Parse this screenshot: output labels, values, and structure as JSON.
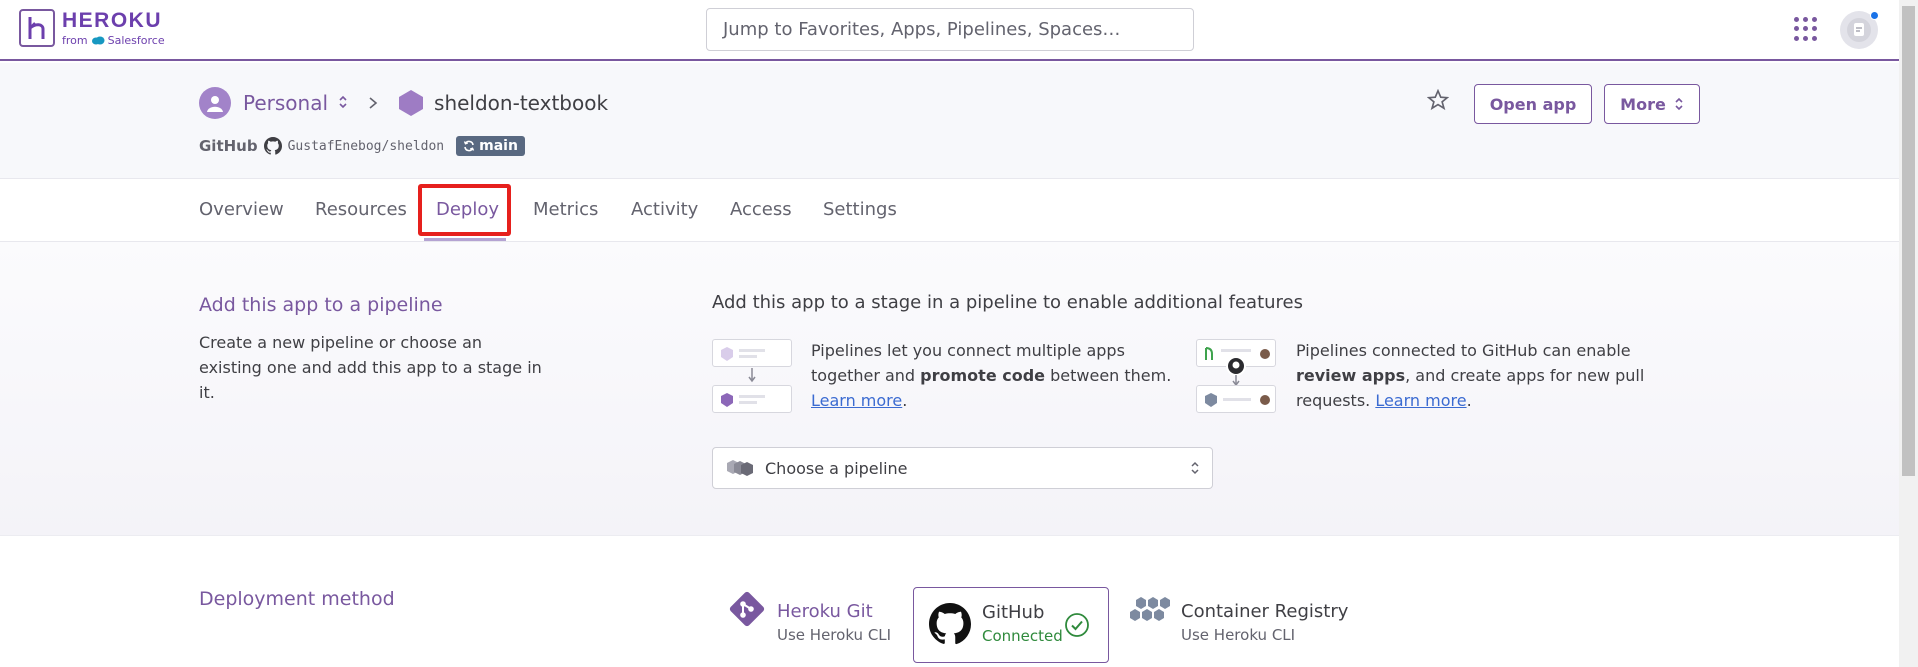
{
  "topbar": {
    "logo_title": "HEROKU",
    "logo_from": "from",
    "logo_brand": "Salesforce",
    "search_placeholder": "Jump to Favorites, Apps, Pipelines, Spaces…"
  },
  "header": {
    "account": "Personal",
    "app_name": "sheldon-textbook",
    "source_label": "GitHub",
    "repo": "GustafEnebog/sheldon",
    "branch": "main",
    "open_app_label": "Open app",
    "more_label": "More"
  },
  "tabs": [
    {
      "label": "Overview"
    },
    {
      "label": "Resources"
    },
    {
      "label": "Deploy"
    },
    {
      "label": "Metrics"
    },
    {
      "label": "Activity"
    },
    {
      "label": "Access"
    },
    {
      "label": "Settings"
    }
  ],
  "active_tab": "Deploy",
  "pipeline": {
    "title": "Add this app to a pipeline",
    "description": "Create a new pipeline or choose an existing one and add this app to a stage in it.",
    "heading": "Add this app to a stage in a pipeline to enable additional features",
    "feature1_a": "Pipelines let you connect multiple apps together and ",
    "feature1_b": "promote code",
    "feature1_c": " between them. ",
    "feature1_link": "Learn more",
    "feature2_a": "Pipelines connected to GitHub can enable ",
    "feature2_b": "review apps",
    "feature2_c": ", and create apps for new pull requests. ",
    "feature2_link": "Learn more",
    "select_placeholder": "Choose a pipeline"
  },
  "deployment": {
    "title": "Deployment method",
    "methods": [
      {
        "name": "Heroku Git",
        "sub": "Use Heroku CLI"
      },
      {
        "name": "GitHub",
        "sub": "Connected"
      },
      {
        "name": "Container Registry",
        "sub": "Use Heroku CLI"
      }
    ]
  },
  "colors": {
    "brand": "#79589f",
    "highlight": "#e6201d",
    "connected": "#2f8a3c",
    "link": "#3b6bd1"
  },
  "icons": [
    "heroku-logo-icon",
    "salesforce-cloud-icon",
    "apps-grid-icon",
    "user-avatar-icon",
    "github-icon",
    "branch-sync-icon",
    "star-icon",
    "git-icon",
    "container-icon",
    "check-circle-icon"
  ]
}
